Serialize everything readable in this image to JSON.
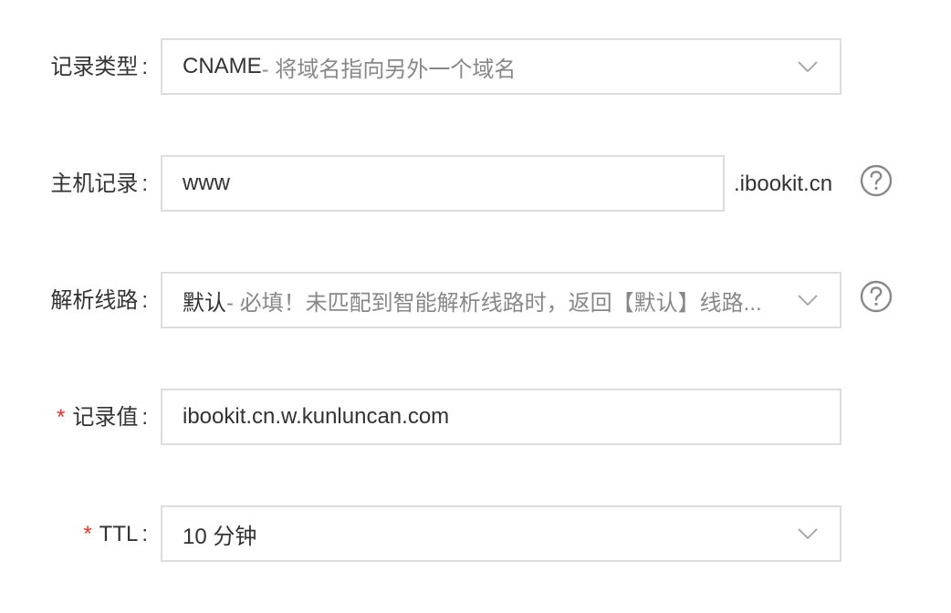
{
  "form": {
    "record_type": {
      "label": "记录类型",
      "value_main": "CNAME",
      "value_hint": "- 将域名指向另外一个域名",
      "icon": "chevron-down-icon"
    },
    "host_record": {
      "label": "主机记录",
      "value": "www",
      "suffix": ".ibookit.cn",
      "help_icon": "help-circle-icon"
    },
    "line": {
      "label": "解析线路",
      "value_main": "默认",
      "value_hint": " - 必填！未匹配到智能解析线路时，返回【默认】线路...",
      "icon": "chevron-down-icon",
      "help_icon": "help-circle-icon"
    },
    "record_value": {
      "required_mark": "*",
      "label": "记录值",
      "value": "ibookit.cn.w.kunluncan.com"
    },
    "ttl": {
      "required_mark": "*",
      "label": "TTL",
      "value": "10 分钟",
      "icon": "chevron-down-icon"
    },
    "colon": ":"
  },
  "colors": {
    "required": "#e0362e",
    "border": "#dddddd",
    "text": "#333333",
    "muted": "#888888",
    "icon": "#aaaaaa"
  }
}
